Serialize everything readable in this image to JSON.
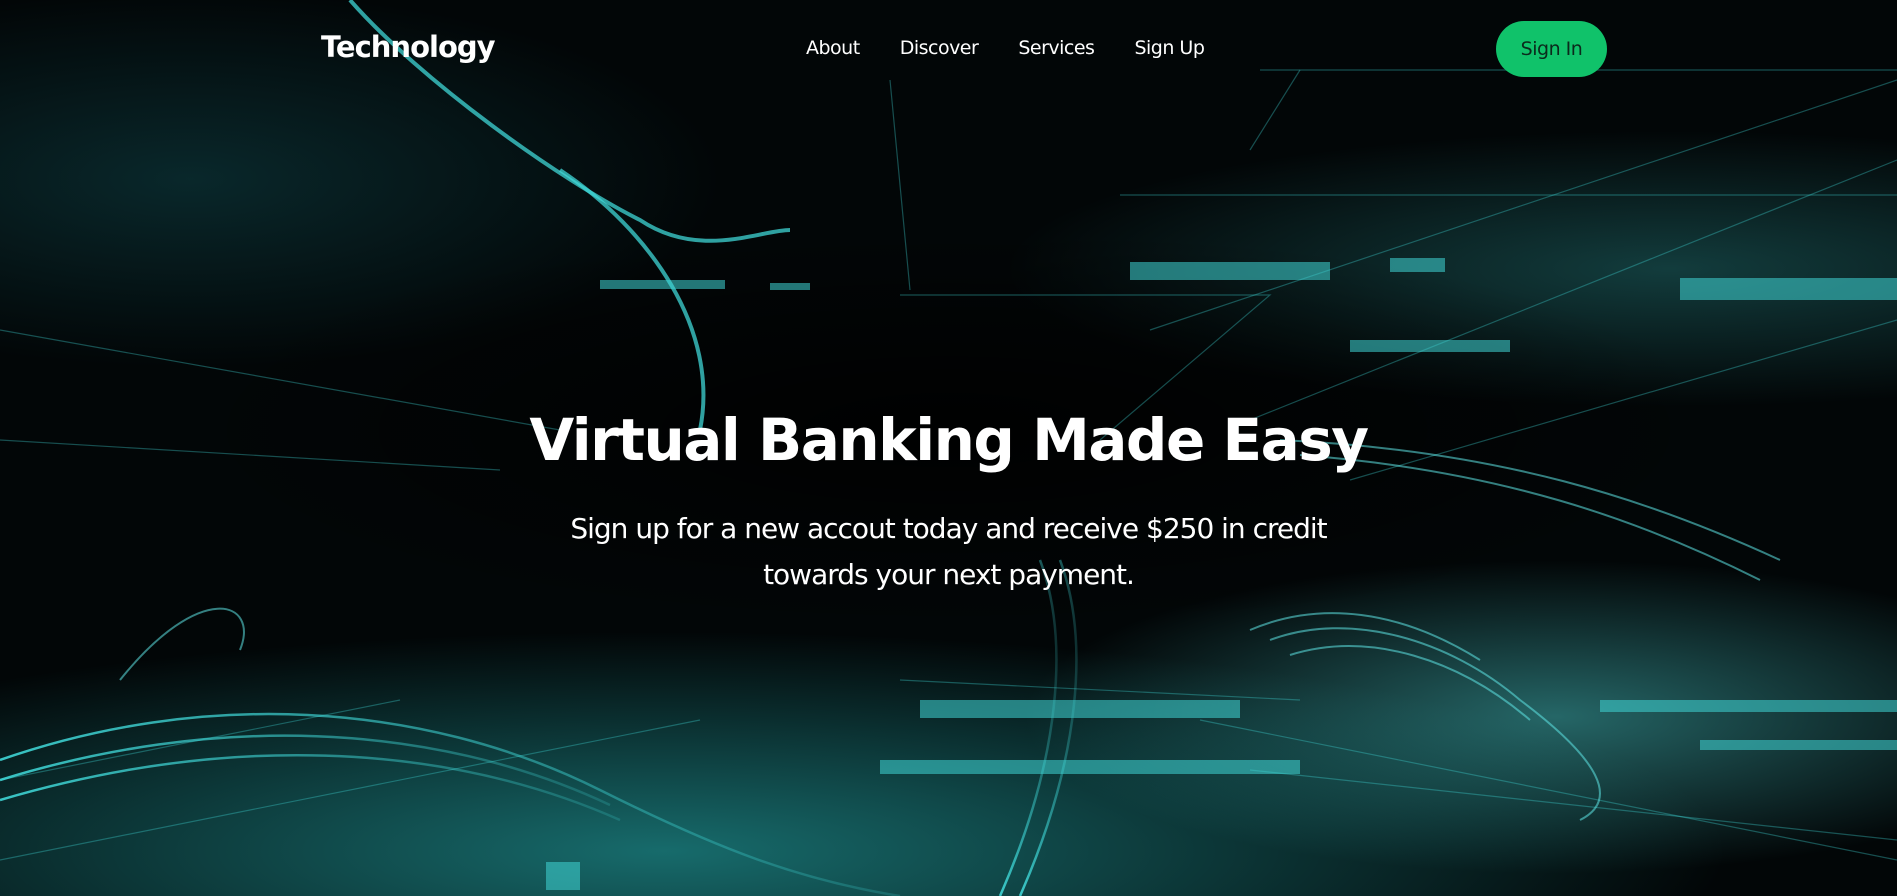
{
  "navbar": {
    "brand": "Technology",
    "links": [
      {
        "label": "About"
      },
      {
        "label": "Discover"
      },
      {
        "label": "Services"
      },
      {
        "label": "Sign Up"
      }
    ],
    "signin_label": "Sign In"
  },
  "hero": {
    "title": "Virtual Banking Made Easy",
    "subtitle": "Sign up for a new accout today and receive $250 in credit towards your next payment."
  },
  "colors": {
    "background": "#000000",
    "accent_teal": "#3fd6d6",
    "signin_button": "#10c26a",
    "text": "#ffffff"
  }
}
